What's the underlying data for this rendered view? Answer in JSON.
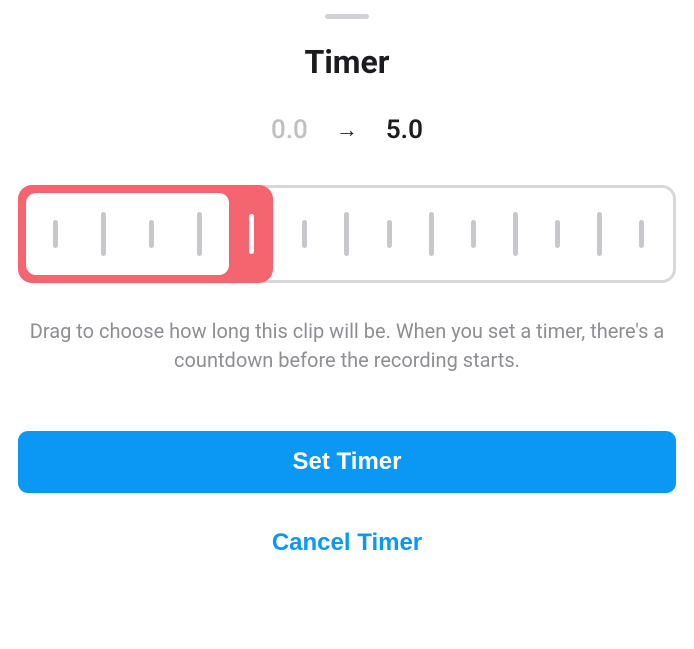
{
  "sheet": {
    "title": "Timer",
    "time_start": "0.0",
    "arrow": "→",
    "time_end": "5.0",
    "help_text": "Drag to choose how long this clip will be. When you set a timer, there's a countdown before the recording starts.",
    "primary_label": "Set Timer",
    "secondary_label": "Cancel Timer"
  }
}
